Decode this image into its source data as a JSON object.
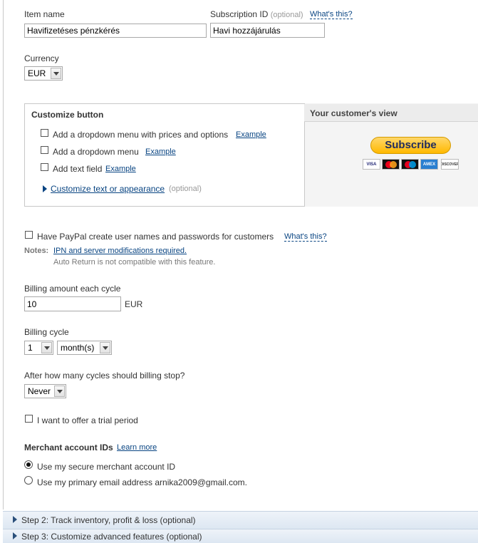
{
  "item": {
    "label": "Item name",
    "value": "Havifizetéses pénzkérés"
  },
  "subscription": {
    "label": "Subscription ID",
    "optional": "(optional)",
    "help": "What's this?",
    "value": "Havi hozzájárulás"
  },
  "currency": {
    "label": "Currency",
    "value": "EUR"
  },
  "customize": {
    "title": "Customize button",
    "options": [
      {
        "label": "Add a dropdown menu with prices and options",
        "link": "Example"
      },
      {
        "label": "Add a dropdown menu",
        "link": "Example"
      },
      {
        "label": "Add text field",
        "link": "Example"
      }
    ],
    "appearance_link": "Customize text or appearance",
    "appearance_optional": "(optional)"
  },
  "preview": {
    "title": "Your customer's view",
    "button_label": "Subscribe",
    "cards": [
      "VISA",
      "MC",
      "Maestro",
      "AMEX",
      "DISCOVER"
    ]
  },
  "paypal_users": {
    "label": "Have PayPal create user names and passwords for customers",
    "help": "What's this?"
  },
  "notes": {
    "label": "Notes:",
    "link": "IPN and server modifications required.",
    "text": "Auto Return is not compatible with this feature."
  },
  "billing_amount": {
    "label": "Billing amount each cycle",
    "value": "10",
    "currency": "EUR"
  },
  "billing_cycle": {
    "label": "Billing cycle",
    "count": "1",
    "unit": "month(s)"
  },
  "billing_stop": {
    "label": "After how many cycles should billing stop?",
    "value": "Never"
  },
  "trial": {
    "label": "I want to offer a trial period"
  },
  "merchant": {
    "label": "Merchant account IDs",
    "link": "Learn more",
    "options": [
      {
        "label": "Use my secure merchant account ID",
        "selected": true
      },
      {
        "label": "Use my primary email address arnika2009@gmail.com.",
        "selected": false
      }
    ]
  },
  "steps": [
    {
      "label": "Step 2: Track inventory, profit & loss (optional)"
    },
    {
      "label": "Step 3: Customize advanced features (optional)"
    }
  ],
  "colors": {
    "link": "#084482",
    "button": "#ffc439",
    "step_bar": "#e5edf6"
  }
}
